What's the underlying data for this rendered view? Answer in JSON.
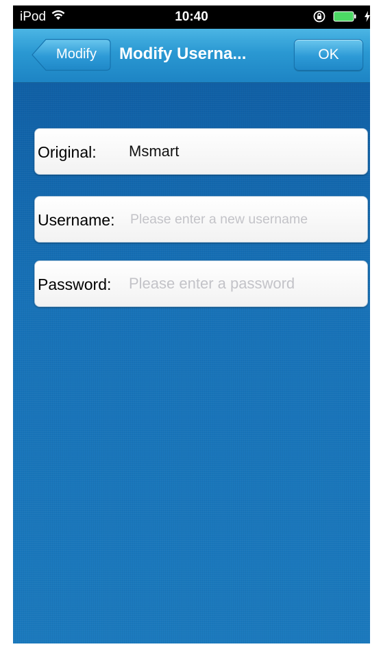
{
  "status_bar": {
    "carrier": "iPod",
    "time": "10:40"
  },
  "nav_bar": {
    "back_label": "Modify",
    "title": "Modify Userna...",
    "ok_label": "OK"
  },
  "form": {
    "original": {
      "label": "Original:",
      "value": "Msmart"
    },
    "username": {
      "label": "Username:",
      "value": "",
      "placeholder": "Please enter a new username"
    },
    "password": {
      "label": "Password:",
      "value": "",
      "placeholder": "Please enter a password"
    }
  },
  "icons": [
    "wifi-icon",
    "rotation-lock-icon",
    "battery-icon",
    "charging-bolt-icon"
  ],
  "colors": {
    "nav_bar": "#2a98d2",
    "background": "#1772b8",
    "placeholder": "#c3c3c8"
  }
}
